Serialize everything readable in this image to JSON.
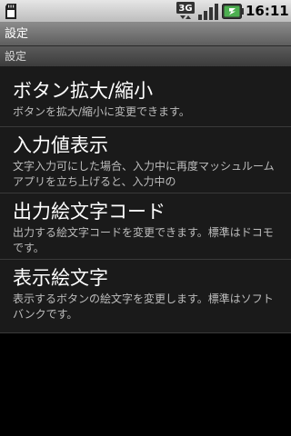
{
  "status_bar": {
    "network_label": "3G",
    "time": "16:11",
    "icons": [
      "sd-card-icon",
      "3g-data-icon",
      "signal-strength-icon",
      "battery-charging-icon"
    ]
  },
  "title_bar": {
    "title": "設定"
  },
  "category": {
    "label": "設定"
  },
  "preferences": [
    {
      "title": "ボタン拡大/縮小",
      "summary": "ボタンを拡大/縮小に変更できます。"
    },
    {
      "title": "入力値表示",
      "summary": "文字入力可にした場合、入力中に再度マッシュルームアプリを立ち上げると、入力中の"
    },
    {
      "title": "出力絵文字コード",
      "summary": "出力する絵文字コードを変更できます。標準はドコモです。"
    },
    {
      "title": "表示絵文字",
      "summary": "表示するボタンの絵文字を変更します。標準はソフトバンクです。"
    }
  ],
  "colors": {
    "background": "#000000",
    "list_background": "#1a1a1a",
    "battery_green": "#4caf50",
    "title_bar": "#6e6e6e"
  }
}
